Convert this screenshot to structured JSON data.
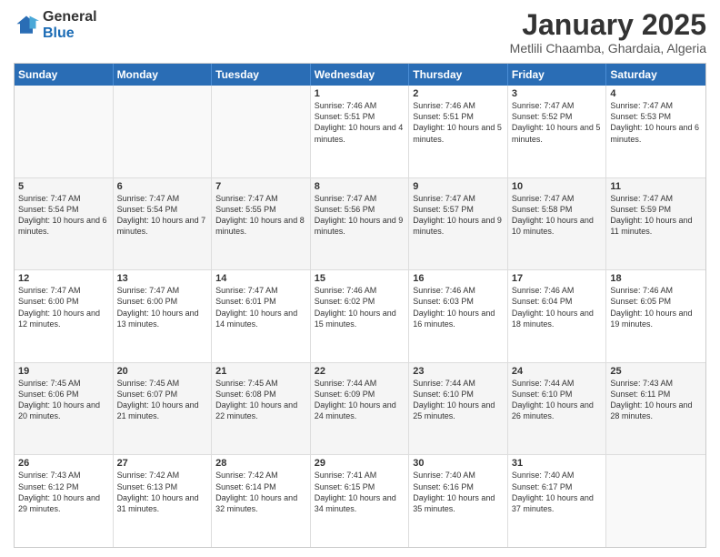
{
  "logo": {
    "general": "General",
    "blue": "Blue"
  },
  "header": {
    "title": "January 2025",
    "subtitle": "Metlili Chaamba, Ghardaia, Algeria"
  },
  "dayHeaders": [
    "Sunday",
    "Monday",
    "Tuesday",
    "Wednesday",
    "Thursday",
    "Friday",
    "Saturday"
  ],
  "weeks": [
    [
      {
        "day": "",
        "info": ""
      },
      {
        "day": "",
        "info": ""
      },
      {
        "day": "",
        "info": ""
      },
      {
        "day": "1",
        "info": "Sunrise: 7:46 AM\nSunset: 5:51 PM\nDaylight: 10 hours and 4 minutes."
      },
      {
        "day": "2",
        "info": "Sunrise: 7:46 AM\nSunset: 5:51 PM\nDaylight: 10 hours and 5 minutes."
      },
      {
        "day": "3",
        "info": "Sunrise: 7:47 AM\nSunset: 5:52 PM\nDaylight: 10 hours and 5 minutes."
      },
      {
        "day": "4",
        "info": "Sunrise: 7:47 AM\nSunset: 5:53 PM\nDaylight: 10 hours and 6 minutes."
      }
    ],
    [
      {
        "day": "5",
        "info": "Sunrise: 7:47 AM\nSunset: 5:54 PM\nDaylight: 10 hours and 6 minutes."
      },
      {
        "day": "6",
        "info": "Sunrise: 7:47 AM\nSunset: 5:54 PM\nDaylight: 10 hours and 7 minutes."
      },
      {
        "day": "7",
        "info": "Sunrise: 7:47 AM\nSunset: 5:55 PM\nDaylight: 10 hours and 8 minutes."
      },
      {
        "day": "8",
        "info": "Sunrise: 7:47 AM\nSunset: 5:56 PM\nDaylight: 10 hours and 9 minutes."
      },
      {
        "day": "9",
        "info": "Sunrise: 7:47 AM\nSunset: 5:57 PM\nDaylight: 10 hours and 9 minutes."
      },
      {
        "day": "10",
        "info": "Sunrise: 7:47 AM\nSunset: 5:58 PM\nDaylight: 10 hours and 10 minutes."
      },
      {
        "day": "11",
        "info": "Sunrise: 7:47 AM\nSunset: 5:59 PM\nDaylight: 10 hours and 11 minutes."
      }
    ],
    [
      {
        "day": "12",
        "info": "Sunrise: 7:47 AM\nSunset: 6:00 PM\nDaylight: 10 hours and 12 minutes."
      },
      {
        "day": "13",
        "info": "Sunrise: 7:47 AM\nSunset: 6:00 PM\nDaylight: 10 hours and 13 minutes."
      },
      {
        "day": "14",
        "info": "Sunrise: 7:47 AM\nSunset: 6:01 PM\nDaylight: 10 hours and 14 minutes."
      },
      {
        "day": "15",
        "info": "Sunrise: 7:46 AM\nSunset: 6:02 PM\nDaylight: 10 hours and 15 minutes."
      },
      {
        "day": "16",
        "info": "Sunrise: 7:46 AM\nSunset: 6:03 PM\nDaylight: 10 hours and 16 minutes."
      },
      {
        "day": "17",
        "info": "Sunrise: 7:46 AM\nSunset: 6:04 PM\nDaylight: 10 hours and 18 minutes."
      },
      {
        "day": "18",
        "info": "Sunrise: 7:46 AM\nSunset: 6:05 PM\nDaylight: 10 hours and 19 minutes."
      }
    ],
    [
      {
        "day": "19",
        "info": "Sunrise: 7:45 AM\nSunset: 6:06 PM\nDaylight: 10 hours and 20 minutes."
      },
      {
        "day": "20",
        "info": "Sunrise: 7:45 AM\nSunset: 6:07 PM\nDaylight: 10 hours and 21 minutes."
      },
      {
        "day": "21",
        "info": "Sunrise: 7:45 AM\nSunset: 6:08 PM\nDaylight: 10 hours and 22 minutes."
      },
      {
        "day": "22",
        "info": "Sunrise: 7:44 AM\nSunset: 6:09 PM\nDaylight: 10 hours and 24 minutes."
      },
      {
        "day": "23",
        "info": "Sunrise: 7:44 AM\nSunset: 6:10 PM\nDaylight: 10 hours and 25 minutes."
      },
      {
        "day": "24",
        "info": "Sunrise: 7:44 AM\nSunset: 6:10 PM\nDaylight: 10 hours and 26 minutes."
      },
      {
        "day": "25",
        "info": "Sunrise: 7:43 AM\nSunset: 6:11 PM\nDaylight: 10 hours and 28 minutes."
      }
    ],
    [
      {
        "day": "26",
        "info": "Sunrise: 7:43 AM\nSunset: 6:12 PM\nDaylight: 10 hours and 29 minutes."
      },
      {
        "day": "27",
        "info": "Sunrise: 7:42 AM\nSunset: 6:13 PM\nDaylight: 10 hours and 31 minutes."
      },
      {
        "day": "28",
        "info": "Sunrise: 7:42 AM\nSunset: 6:14 PM\nDaylight: 10 hours and 32 minutes."
      },
      {
        "day": "29",
        "info": "Sunrise: 7:41 AM\nSunset: 6:15 PM\nDaylight: 10 hours and 34 minutes."
      },
      {
        "day": "30",
        "info": "Sunrise: 7:40 AM\nSunset: 6:16 PM\nDaylight: 10 hours and 35 minutes."
      },
      {
        "day": "31",
        "info": "Sunrise: 7:40 AM\nSunset: 6:17 PM\nDaylight: 10 hours and 37 minutes."
      },
      {
        "day": "",
        "info": ""
      }
    ]
  ]
}
